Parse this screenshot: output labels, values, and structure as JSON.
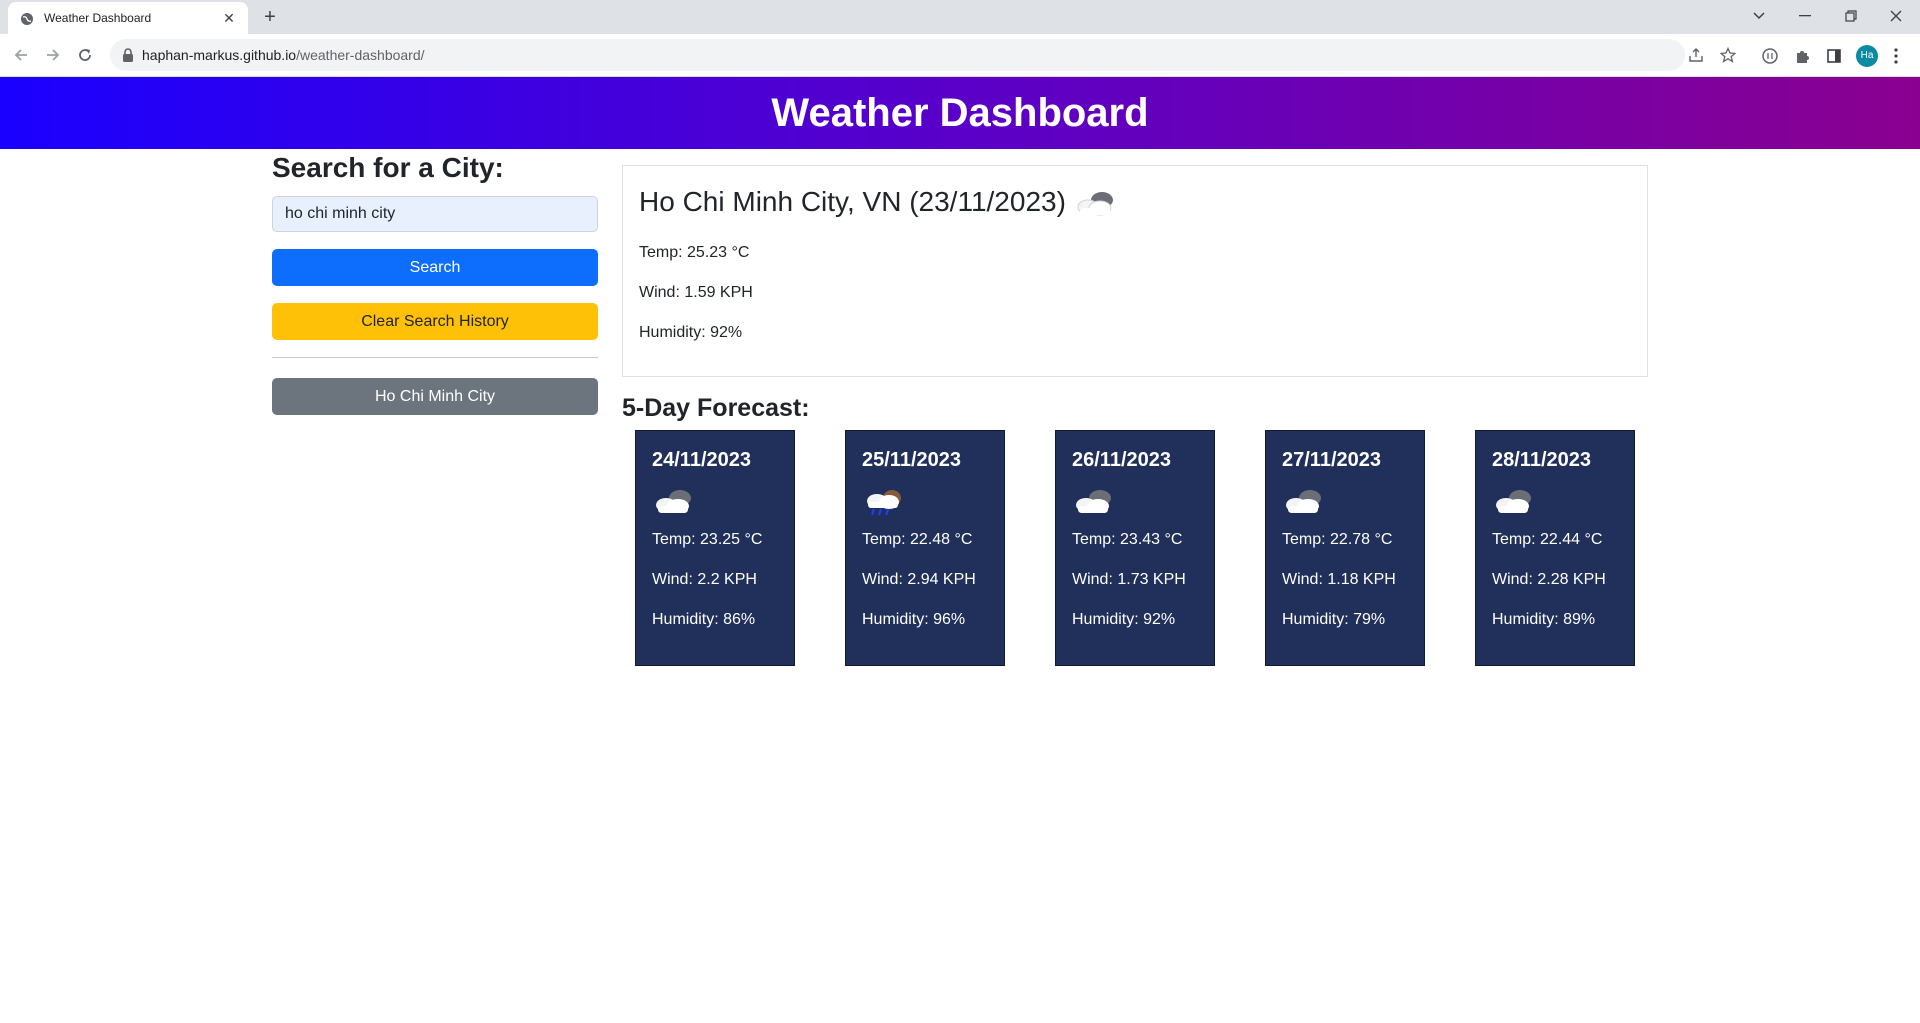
{
  "browser": {
    "tab_title": "Weather Dashboard",
    "url_host": "haphan-markus.github.io",
    "url_path": "/weather-dashboard/",
    "profile_initials": "Ha"
  },
  "header": {
    "title": "Weather Dashboard"
  },
  "search": {
    "heading": "Search for a City:",
    "input_value": "ho chi minh city",
    "search_label": "Search",
    "clear_label": "Clear Search History",
    "history": [
      {
        "label": "Ho Chi Minh City"
      }
    ]
  },
  "current": {
    "title": "Ho Chi Minh City, VN (23/11/2023)",
    "icon": "cloudy-icon",
    "temp": "Temp: 25.23 °C",
    "wind": "Wind: 1.59 KPH",
    "humidity": "Humidity: 92%"
  },
  "forecast": {
    "heading": "5-Day Forecast:",
    "days": [
      {
        "date": "24/11/2023",
        "icon": "cloudy-icon",
        "temp": "Temp: 23.25 °C",
        "wind": "Wind: 2.2 KPH",
        "humidity": "Humidity: 86%"
      },
      {
        "date": "25/11/2023",
        "icon": "rain-icon",
        "temp": "Temp: 22.48 °C",
        "wind": "Wind: 2.94 KPH",
        "humidity": "Humidity: 96%"
      },
      {
        "date": "26/11/2023",
        "icon": "cloudy-icon",
        "temp": "Temp: 23.43 °C",
        "wind": "Wind: 1.73 KPH",
        "humidity": "Humidity: 92%"
      },
      {
        "date": "27/11/2023",
        "icon": "cloudy-icon",
        "temp": "Temp: 22.78 °C",
        "wind": "Wind: 1.18 KPH",
        "humidity": "Humidity: 79%"
      },
      {
        "date": "28/11/2023",
        "icon": "cloudy-icon",
        "temp": "Temp: 22.44 °C",
        "wind": "Wind: 2.28 KPH",
        "humidity": "Humidity: 89%"
      }
    ]
  },
  "colors": {
    "header_gradient_start": "#1a00ff",
    "header_gradient_end": "#8a0090",
    "search_button": "#0d6efd",
    "clear_button": "#ffc107",
    "history_button": "#6c757d",
    "forecast_card": "#20305a"
  }
}
